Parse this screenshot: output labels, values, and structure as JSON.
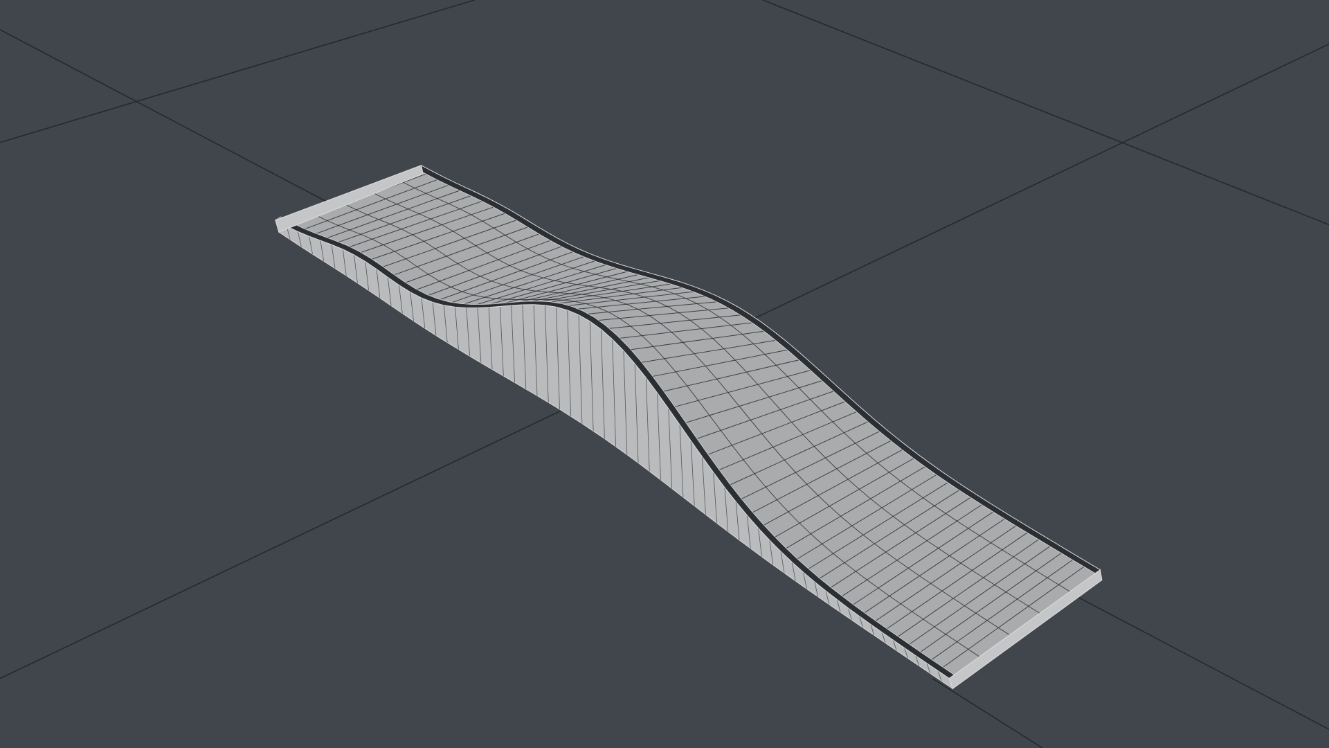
{
  "viewport": {
    "background_color": "#41464d",
    "grid_line_color": "#25292e",
    "mesh": {
      "surface_color": "#a9abad",
      "edge_color": "#2a2d31",
      "rim_color": "#2b2e32",
      "outline_color": "#d8d9da"
    }
  }
}
